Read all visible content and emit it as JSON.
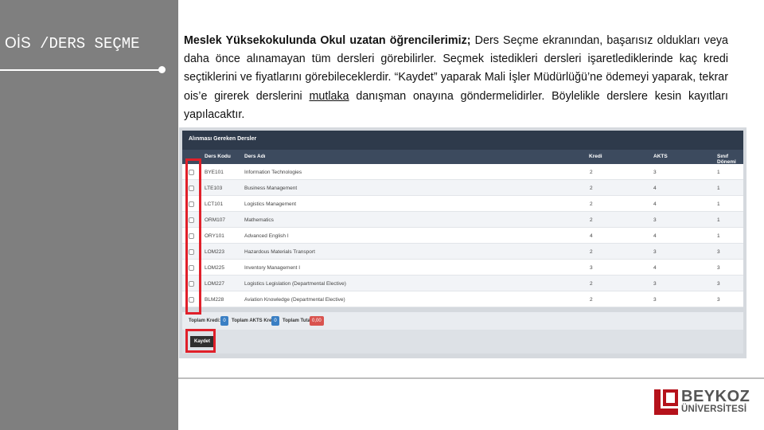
{
  "slide": {
    "title_part1": "OİS",
    "title_part2": " /DERS SEÇME"
  },
  "body": {
    "bold_intro": "Meslek Yüksekokulunda Okul uzatan öğrencilerimiz;",
    "text_a": " Ders Seçme ekranından, başarısız oldukları veya daha önce alınamayan tüm dersleri görebilirler. Seçmek istedikleri dersleri işaretlediklerinde kaç kredi seçtiklerini ve fiyatlarını görebileceklerdir. “Kaydet” yaparak Mali İşler Müdürlüğü’ne ödemeyi yaparak, tekrar ois’e girerek derslerini ",
    "underlined": "mutlaka",
    "text_b": " danışman onayına göndermelidirler. Böylelikle derslere kesin kayıtları yapılacaktır."
  },
  "screenshot": {
    "panel_title": "Alınması Gereken Dersler",
    "columns": {
      "code": "Ders Kodu",
      "name": "Ders Adı",
      "credit": "Kredi",
      "akts": "AKTS",
      "semester": "Sınıf Dönemi"
    },
    "rows": [
      {
        "code": "BYE101",
        "name": "Information Technologies",
        "credit": "2",
        "akts": "3",
        "semester": "1"
      },
      {
        "code": "LTE103",
        "name": "Business Management",
        "credit": "2",
        "akts": "4",
        "semester": "1"
      },
      {
        "code": "LCT101",
        "name": "Logistics Management",
        "credit": "2",
        "akts": "4",
        "semester": "1"
      },
      {
        "code": "ORM107",
        "name": "Mathematics",
        "credit": "2",
        "akts": "3",
        "semester": "1"
      },
      {
        "code": "ORY101",
        "name": "Advanced English I",
        "credit": "4",
        "akts": "4",
        "semester": "1"
      },
      {
        "code": "LOM223",
        "name": "Hazardous Materials Transport",
        "credit": "2",
        "akts": "3",
        "semester": "3"
      },
      {
        "code": "LOM225",
        "name": "Inventory Management I",
        "credit": "3",
        "akts": "4",
        "semester": "3"
      },
      {
        "code": "LOM227",
        "name": "Logistics Legislation (Departmental Elective)",
        "credit": "2",
        "akts": "3",
        "semester": "3"
      },
      {
        "code": "BLM228",
        "name": "Aviation Knowledge (Departmental Elective)",
        "credit": "2",
        "akts": "3",
        "semester": "3"
      }
    ],
    "totals": {
      "credit_label": "Toplam Kredi:",
      "credit_value": "0",
      "akts_label": "Toplam AKTS Kredi:",
      "akts_value": "0",
      "price_label": "Toplam Tutar:",
      "price_value": "0,00"
    },
    "save_label": "Kaydet"
  },
  "logo": {
    "line1": "BEYKOZ",
    "line2": "ÜNİVERSİTESİ"
  },
  "colors": {
    "left_panel": "#7f7f7f",
    "highlight": "#e0202a",
    "logo_red": "#b5121b"
  }
}
